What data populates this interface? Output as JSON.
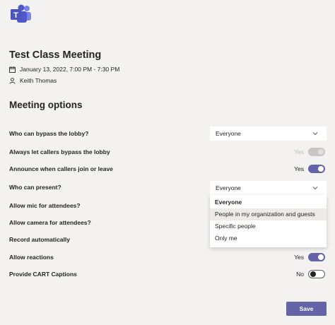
{
  "meeting": {
    "title": "Test Class Meeting",
    "datetime": "January 13, 2022, 7:00 PM - 7:30 PM",
    "organizer": "Keith Thomas"
  },
  "section_title": "Meeting options",
  "options": {
    "bypass_lobby": {
      "label": "Who can bypass the lobby?",
      "value": "Everyone"
    },
    "callers_bypass": {
      "label": "Always let callers bypass the lobby",
      "state": "Yes"
    },
    "announce_callers": {
      "label": "Announce when callers join or leave",
      "state": "Yes"
    },
    "who_present": {
      "label": "Who can present?",
      "value": "Everyone"
    },
    "allow_mic": {
      "label": "Allow mic for attendees?"
    },
    "allow_camera": {
      "label": "Allow camera for attendees?"
    },
    "record_auto": {
      "label": "Record automatically"
    },
    "allow_reactions": {
      "label": "Allow reactions",
      "state": "Yes"
    },
    "cart_captions": {
      "label": "Provide CART Captions",
      "state": "No"
    }
  },
  "present_dropdown": {
    "options": [
      "Everyone",
      "People in my organization and guests",
      "Specific people",
      "Only me"
    ]
  },
  "save_label": "Save",
  "colors": {
    "accent": "#6264a7",
    "background": "#f3f2f1"
  },
  "icons": {
    "app": "teams-logo-icon",
    "calendar": "calendar-icon",
    "person": "person-icon",
    "chevron": "chevron-down-icon"
  }
}
